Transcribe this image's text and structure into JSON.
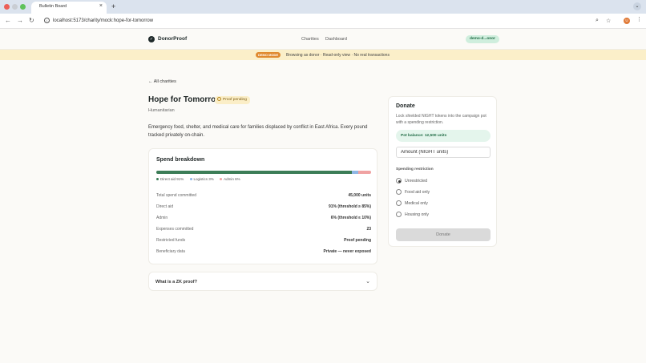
{
  "browser": {
    "tab_title": "Bulletin Board",
    "tab_close": "×",
    "new_tab": "+",
    "url": "localhost:5173/charity/mock:hope-for-tomorrow",
    "profile_initial": "U"
  },
  "header": {
    "logo": "DonorProof",
    "nav": [
      "Charities",
      "Dashboard"
    ],
    "user": "demo-d...onor"
  },
  "banner": {
    "badge": "DEMO MODE",
    "text": "Browsing as donor · Read-only view · No real transactions"
  },
  "page": {
    "back": "← All charities",
    "title": "Hope for Tomorrow",
    "status": "Proof pending",
    "category": "Humanitarian",
    "description": "Emergency food, shelter, and medical care for families displaced by conflict in East Africa. Every pound tracked privately on-chain."
  },
  "spend": {
    "title": "Spend breakdown",
    "shares": [
      {
        "label": "Direct aid 91%",
        "fraction": 0.91,
        "color": "#3c7d57"
      },
      {
        "label": "Logistics 3%",
        "fraction": 0.03,
        "color": "#8fb7e5"
      },
      {
        "label": "Admin 6%",
        "fraction": 0.06,
        "color": "#f0a2a2"
      }
    ],
    "rows": [
      {
        "label": "Total spend committed",
        "value": "45,000 units"
      },
      {
        "label": "Direct aid",
        "value": "91% (threshold ≥ 85%)"
      },
      {
        "label": "Admin",
        "value": "6% (threshold ≤ 10%)"
      },
      {
        "label": "Expenses committed",
        "value": "23"
      },
      {
        "label": "Restricted funds",
        "value": "Proof pending"
      },
      {
        "label": "Beneficiary data",
        "value": "Private — never exposed"
      }
    ]
  },
  "zk": {
    "question": "What is a ZK proof?"
  },
  "donate": {
    "title": "Donate",
    "description": "Lock shielded NIGHT tokens into the campaign pot with a spending restriction.",
    "pot_balance": "Pot balance: 12,500 units",
    "amount_placeholder": "Amount (NIGHT units)",
    "restriction_label": "Spending restriction",
    "options": [
      "Unrestricted",
      "Food aid only",
      "Medical only",
      "Housing only"
    ],
    "selected_option": "Unrestricted",
    "button": "Donate"
  }
}
